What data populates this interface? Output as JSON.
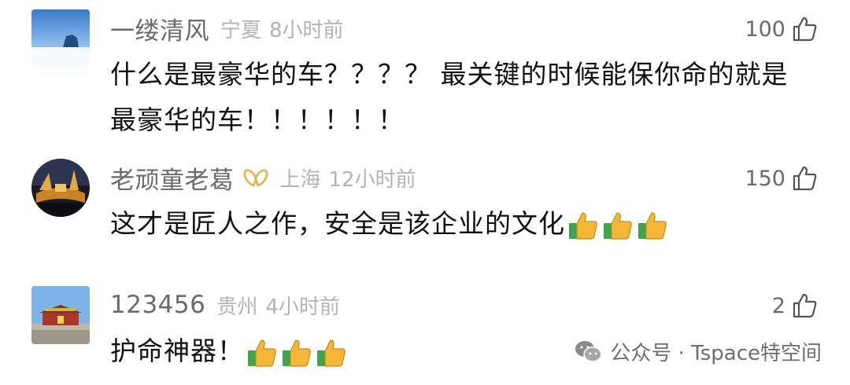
{
  "comments": [
    {
      "username": "一缕清风",
      "location": "宁夏",
      "time": "8小时前",
      "likes": "100",
      "text": "什么是最豪华的车？？？？ 最关键的时候能保你命的就是最豪华的车！！！！！！",
      "emoji_count": 0,
      "avatar_icon": "snow-landscape"
    },
    {
      "username": "老顽童老葛",
      "location": "上海",
      "time": "12小时前",
      "likes": "150",
      "text": "这才是匠人之作，安全是该企业的文化",
      "emoji_count": 3,
      "emoji": "thumbs-up",
      "avatar_icon": "night-plaza",
      "badge_icon": "vip-badge-icon"
    },
    {
      "username": "123456",
      "location": "贵州",
      "time": "4小时前",
      "likes": "2",
      "text": "护命神器！",
      "emoji_count": 3,
      "emoji": "thumbs-up",
      "avatar_icon": "tiananmen"
    }
  ],
  "watermark": {
    "text": "公众号 · Tspace特空间",
    "icon": "wechat-icon"
  },
  "colors": {
    "username": "#6a6a6a",
    "meta": "#b3b3b3",
    "text": "#111111",
    "badge": "#e8b04a"
  }
}
